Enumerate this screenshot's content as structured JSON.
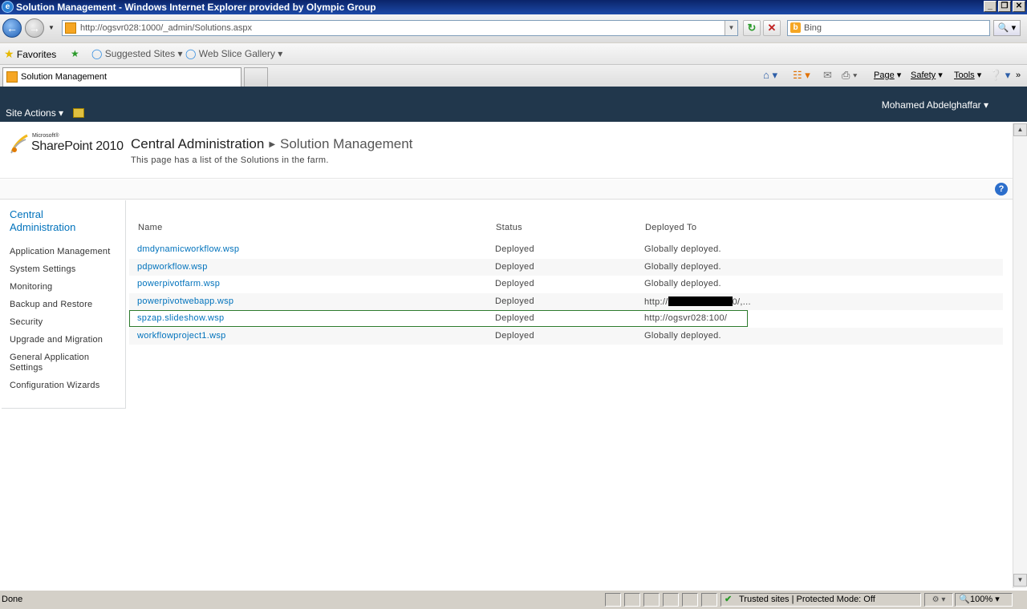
{
  "window": {
    "title": "Solution Management - Windows Internet Explorer provided by Olympic Group",
    "buttons": [
      "_",
      "❐",
      "✕"
    ]
  },
  "browser": {
    "address": "http://ogsvr028:1000/_admin/Solutions.aspx",
    "search_placeholder": "Bing",
    "favorites_label": "Favorites",
    "suggested_sites": "Suggested Sites",
    "web_slice_gallery": "Web Slice Gallery",
    "tab_title": "Solution Management",
    "commands": {
      "page": "Page",
      "safety": "Safety",
      "tools": "Tools"
    }
  },
  "ribbon": {
    "site_actions": "Site Actions",
    "user": "Mohamed Abdelghaffar"
  },
  "header": {
    "logo_ms": "Microsoft®",
    "logo_text": "SharePoint 2010",
    "breadcrumb_root": "Central Administration",
    "breadcrumb_current": "Solution Management",
    "description": "This page has a list of the Solutions in the farm."
  },
  "quicklaunch": {
    "heading": "Central Administration",
    "items": [
      "Application Management",
      "System Settings",
      "Monitoring",
      "Backup and Restore",
      "Security",
      "Upgrade and Migration",
      "General Application Settings",
      "Configuration Wizards"
    ]
  },
  "table": {
    "columns": [
      "Name",
      "Status",
      "Deployed To"
    ],
    "rows": [
      {
        "name": "dmdynamicworkflow.wsp",
        "status": "Deployed",
        "deployed_to": "Globally deployed."
      },
      {
        "name": "pdpworkflow.wsp",
        "status": "Deployed",
        "deployed_to": "Globally deployed."
      },
      {
        "name": "powerpivotfarm.wsp",
        "status": "Deployed",
        "deployed_to": "Globally deployed."
      },
      {
        "name": "powerpivotwebapp.wsp",
        "status": "Deployed",
        "deployed_to_prefix": "http://",
        "deployed_to_suffix": "0/,..."
      },
      {
        "name": "spzap.slideshow.wsp",
        "status": "Deployed",
        "deployed_to": "http://ogsvr028:100/"
      },
      {
        "name": "workflowproject1.wsp",
        "status": "Deployed",
        "deployed_to": "Globally deployed."
      }
    ]
  },
  "statusbar": {
    "text": "Done",
    "zone": "Trusted sites | Protected Mode: Off",
    "zoom": "100%"
  }
}
